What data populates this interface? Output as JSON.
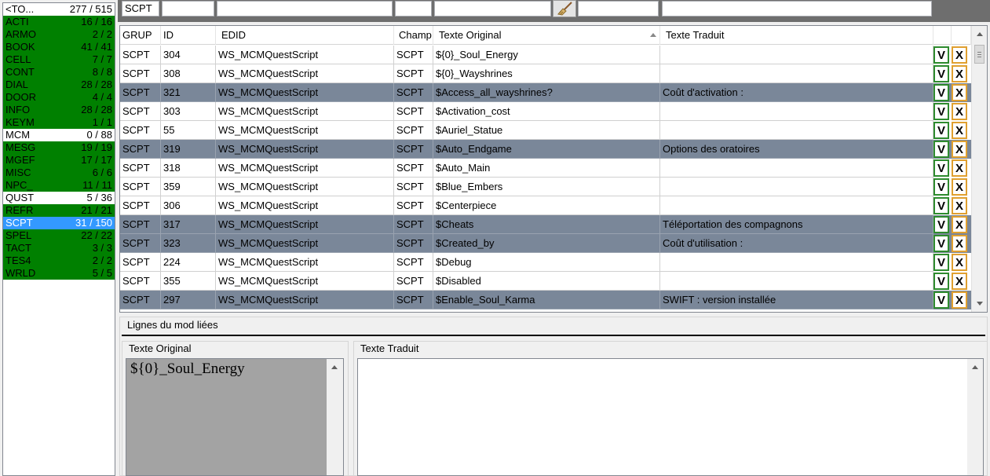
{
  "categories": [
    {
      "name": "<TO...",
      "count": "277 / 515",
      "state": "white"
    },
    {
      "name": "ACTI",
      "count": "16 / 16",
      "state": "green"
    },
    {
      "name": "ARMO",
      "count": "2 / 2",
      "state": "green"
    },
    {
      "name": "BOOK",
      "count": "41 / 41",
      "state": "green"
    },
    {
      "name": "CELL",
      "count": "7 / 7",
      "state": "green"
    },
    {
      "name": "CONT",
      "count": "8 / 8",
      "state": "green"
    },
    {
      "name": "DIAL",
      "count": "28 / 28",
      "state": "green"
    },
    {
      "name": "DOOR",
      "count": "4 / 4",
      "state": "green"
    },
    {
      "name": "INFO",
      "count": "28 / 28",
      "state": "green"
    },
    {
      "name": "KEYM",
      "count": "1 / 1",
      "state": "green"
    },
    {
      "name": "MCM",
      "count": "0 / 88",
      "state": "white"
    },
    {
      "name": "MESG",
      "count": "19 / 19",
      "state": "green"
    },
    {
      "name": "MGEF",
      "count": "17 / 17",
      "state": "green"
    },
    {
      "name": "MISC",
      "count": "6 / 6",
      "state": "green"
    },
    {
      "name": "NPC_",
      "count": "11 / 11",
      "state": "green"
    },
    {
      "name": "QUST",
      "count": "5 / 36",
      "state": "white"
    },
    {
      "name": "REFR",
      "count": "21 / 21",
      "state": "green"
    },
    {
      "name": "SCPT",
      "count": "31 / 150",
      "state": "selected"
    },
    {
      "name": "SPEL",
      "count": "22 / 22",
      "state": "green"
    },
    {
      "name": "TACT",
      "count": "3 / 3",
      "state": "green"
    },
    {
      "name": "TES4",
      "count": "2 / 2",
      "state": "green"
    },
    {
      "name": "WRLD",
      "count": "5 / 5",
      "state": "green"
    }
  ],
  "filters": {
    "grup": "SCPT",
    "id": "",
    "edid": "",
    "champ": "",
    "original": "",
    "extra": "",
    "traduit": ""
  },
  "columns": [
    "GRUP",
    "ID",
    "EDID",
    "Champ",
    "Texte Original",
    "Texte Traduit"
  ],
  "rows": [
    {
      "grup": "SCPT",
      "id": "304",
      "edid": "WS_MCMQuestScript",
      "champ": "SCPT",
      "original": "${0}_Soul_Energy",
      "traduit": "",
      "hl": false
    },
    {
      "grup": "SCPT",
      "id": "308",
      "edid": "WS_MCMQuestScript",
      "champ": "SCPT",
      "original": "${0}_Wayshrines",
      "traduit": "",
      "hl": false
    },
    {
      "grup": "SCPT",
      "id": "321",
      "edid": "WS_MCMQuestScript",
      "champ": "SCPT",
      "original": "$Access_all_wayshrines?",
      "traduit": "Coût d'activation :",
      "hl": true
    },
    {
      "grup": "SCPT",
      "id": "303",
      "edid": "WS_MCMQuestScript",
      "champ": "SCPT",
      "original": "$Activation_cost",
      "traduit": "",
      "hl": false
    },
    {
      "grup": "SCPT",
      "id": "55",
      "edid": "WS_MCMQuestScript",
      "champ": "SCPT",
      "original": "$Auriel_Statue",
      "traduit": "",
      "hl": false
    },
    {
      "grup": "SCPT",
      "id": "319",
      "edid": "WS_MCMQuestScript",
      "champ": "SCPT",
      "original": "$Auto_Endgame",
      "traduit": "Options des oratoires",
      "hl": true
    },
    {
      "grup": "SCPT",
      "id": "318",
      "edid": "WS_MCMQuestScript",
      "champ": "SCPT",
      "original": "$Auto_Main",
      "traduit": "",
      "hl": false
    },
    {
      "grup": "SCPT",
      "id": "359",
      "edid": "WS_MCMQuestScript",
      "champ": "SCPT",
      "original": "$Blue_Embers",
      "traduit": "",
      "hl": false
    },
    {
      "grup": "SCPT",
      "id": "306",
      "edid": "WS_MCMQuestScript",
      "champ": "SCPT",
      "original": "$Centerpiece",
      "traduit": "",
      "hl": false
    },
    {
      "grup": "SCPT",
      "id": "317",
      "edid": "WS_MCMQuestScript",
      "champ": "SCPT",
      "original": "$Cheats",
      "traduit": "Téléportation des compagnons",
      "hl": true
    },
    {
      "grup": "SCPT",
      "id": "323",
      "edid": "WS_MCMQuestScript",
      "champ": "SCPT",
      "original": "$Created_by",
      "traduit": "Coût d'utilisation :",
      "hl": true
    },
    {
      "grup": "SCPT",
      "id": "224",
      "edid": "WS_MCMQuestScript",
      "champ": "SCPT",
      "original": "$Debug",
      "traduit": "",
      "hl": false
    },
    {
      "grup": "SCPT",
      "id": "355",
      "edid": "WS_MCMQuestScript",
      "champ": "SCPT",
      "original": "$Disabled",
      "traduit": "",
      "hl": false
    },
    {
      "grup": "SCPT",
      "id": "297",
      "edid": "WS_MCMQuestScript",
      "champ": "SCPT",
      "original": "$Enable_Soul_Karma",
      "traduit": "SWIFT : version installée",
      "hl": true
    }
  ],
  "buttons": {
    "validate": "V",
    "cancel": "X"
  },
  "bottom": {
    "linked_title": "Lignes du mod liées",
    "original_title": "Texte Original",
    "original_text": "${0}_Soul_Energy",
    "traduit_title": "Texte Traduit",
    "traduit_text": ""
  },
  "colors": {
    "green": "#008000",
    "selected": "#3399ff",
    "row_highlight": "#7a8799",
    "validate_border": "#2e8b2e",
    "cancel_border": "#e0a030"
  }
}
